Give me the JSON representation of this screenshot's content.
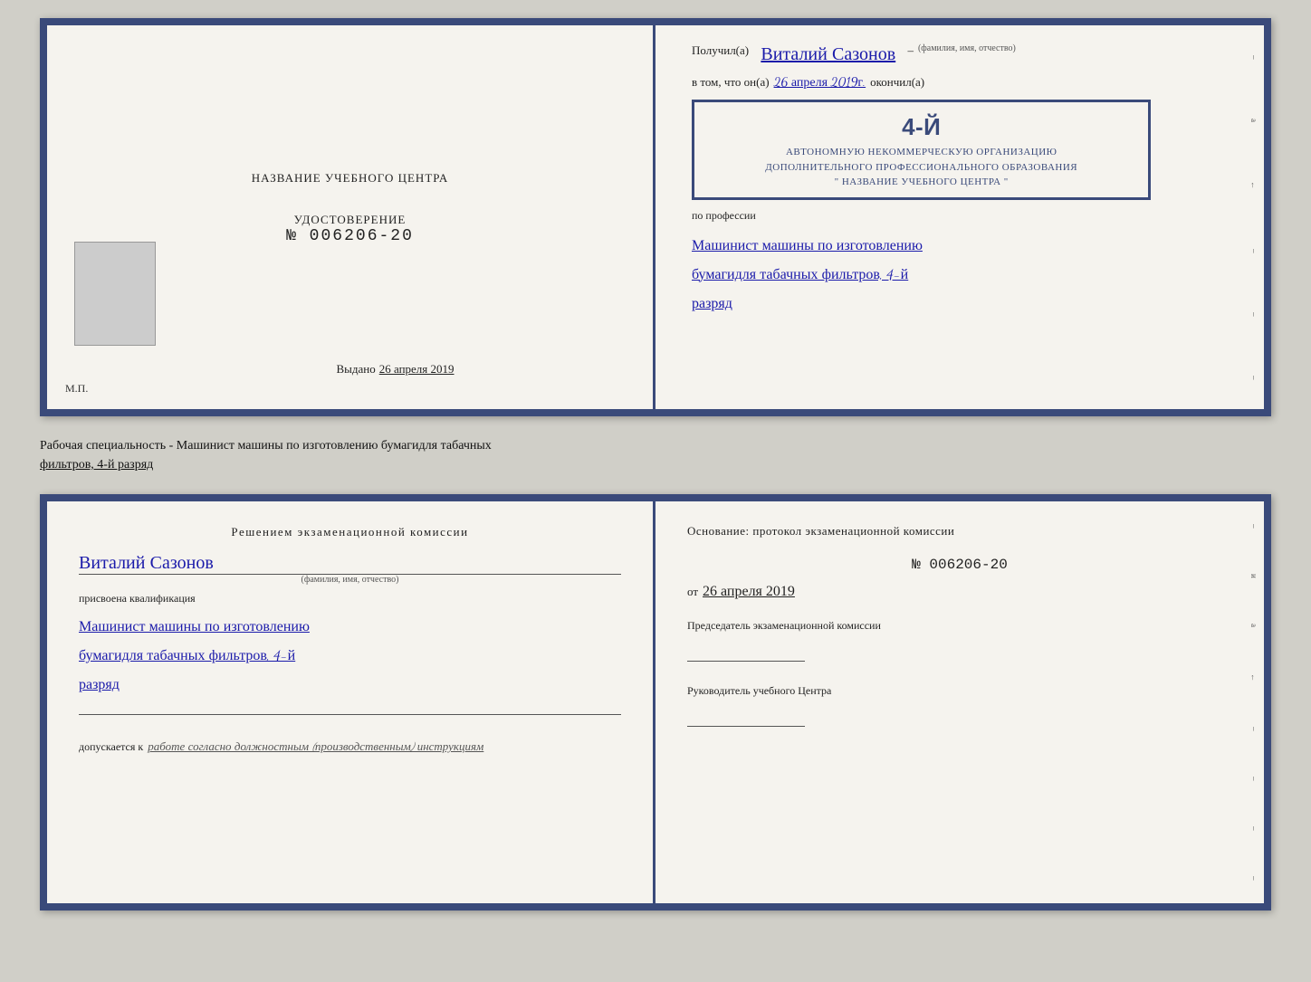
{
  "top_cert": {
    "left": {
      "title": "НАЗВАНИЕ УЧЕБНОГО ЦЕНТРА",
      "cert_label": "УДОСТОВЕРЕНИЕ",
      "cert_number": "№ 006206-20",
      "issued_label": "Выдано",
      "issued_date": "26 апреля 2019",
      "mp_label": "М.П."
    },
    "right": {
      "received_label": "Получил(а)",
      "name_handwritten": "Виталий Сазонов",
      "name_sub": "(фамилия, имя, отчество)",
      "dash": "–",
      "in_that_label": "в том, что он(а)",
      "date_handwritten": "26 апреля 2019г.",
      "finished_label": "окончил(а)",
      "org_line1": "АВТОНОМНУЮ НЕКОММЕРЧЕСКУЮ ОРГАНИЗАЦИЮ",
      "org_line2": "ДОПОЛНИТЕЛЬНОГО ПРОФЕССИОНАЛЬНОГО ОБРАЗОВАНИЯ",
      "org_name": "\" НАЗВАНИЕ УЧЕБНОГО ЦЕНТРА \"",
      "profession_label": "по профессии",
      "profession_handwritten_1": "Машинист машины по изготовлению",
      "profession_handwritten_2": "бумагидля табачных фильтров, 4-й",
      "profession_handwritten_3": "разряд",
      "stamp_num": "4-й"
    }
  },
  "meta": {
    "text_line1": "Рабочая специальность - Машинист машины по изготовлению бумагидля табачных",
    "text_line2_underline": "фильтров, 4-й разряд"
  },
  "bottom_cert": {
    "left": {
      "decision_title": "Решением  экзаменационной  комиссии",
      "name_handwritten": "Виталий Сазонов",
      "name_sub": "(фамилия, имя, отчество)",
      "assign_label": "присвоена квалификация",
      "profession_h1": "Машинист машины по изготовлению",
      "profession_h2": "бумагидля табачных фильтров, 4-й",
      "profession_h3": "разряд",
      "allowed_label": "допускается к",
      "allowed_value": "работе согласно должностным (производственным) инструкциям"
    },
    "right": {
      "basis_label": "Основание: протокол экзаменационной  комиссии",
      "number": "№  006206-20",
      "date_prefix": "от",
      "date_value": "26 апреля 2019",
      "chairman_label": "Председатель экзаменационной комиссии",
      "head_label": "Руководитель учебного Центра"
    }
  },
  "edge_marks": [
    "–",
    "a",
    "←",
    "–",
    "–",
    "–",
    "–",
    "–"
  ]
}
